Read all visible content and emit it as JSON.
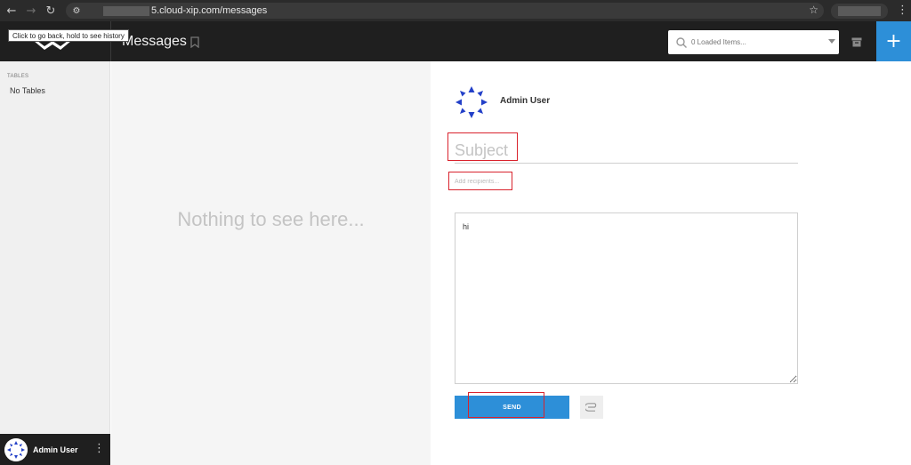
{
  "browser": {
    "back_icon": "arrow-left-icon",
    "forward_icon": "arrow-right-icon",
    "reload_icon": "reload-icon",
    "url": "5.cloud-xip.com/messages",
    "tooltip": "Click to go back, hold to see history"
  },
  "header": {
    "title": "Messages",
    "search_placeholder": "0 Loaded Items...",
    "add_label": "+"
  },
  "sidebar": {
    "section_heading": "TABLES",
    "empty_text": "No Tables",
    "user_name": "Admin User"
  },
  "list_pane": {
    "empty_message": "Nothing to see here..."
  },
  "compose": {
    "sender_name": "Admin User",
    "subject_placeholder": "Subject",
    "recipients_placeholder": "Add recipients...",
    "body_value": "hi",
    "send_label": "SEND"
  },
  "colors": {
    "accent": "#2d8fd8",
    "header_bg": "#1f1f1f",
    "highlight": "#d9232d"
  }
}
